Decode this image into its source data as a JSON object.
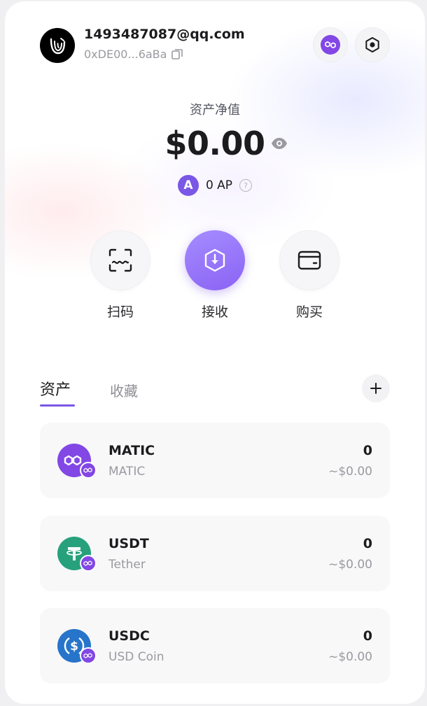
{
  "account": {
    "email": "1493487087@qq.com",
    "address": "0xDE00...6aBa"
  },
  "header_icons": [
    "polygon-network-icon",
    "settings-hexagon-icon"
  ],
  "net_worth": {
    "label": "资产净值",
    "value": "$0.00",
    "points": "0 AP",
    "points_badge": "A"
  },
  "actions": [
    {
      "label": "扫码",
      "icon": "scan-icon"
    },
    {
      "label": "接收",
      "icon": "receive-icon"
    },
    {
      "label": "购买",
      "icon": "wallet-card-icon"
    }
  ],
  "tabs": {
    "assets": "资产",
    "collectibles": "收藏",
    "add": "+"
  },
  "assets": [
    {
      "symbol": "MATIC",
      "name": "MATIC",
      "amount": "0",
      "value": "~$0.00",
      "color": "#8247e5"
    },
    {
      "symbol": "USDT",
      "name": "Tether",
      "amount": "0",
      "value": "~$0.00",
      "color": "#26a17b"
    },
    {
      "symbol": "USDC",
      "name": "USD Coin",
      "amount": "0",
      "value": "~$0.00",
      "color": "#2775ca"
    }
  ],
  "colors": {
    "accent": "#7b57e6",
    "polygon": "#8247e5"
  }
}
